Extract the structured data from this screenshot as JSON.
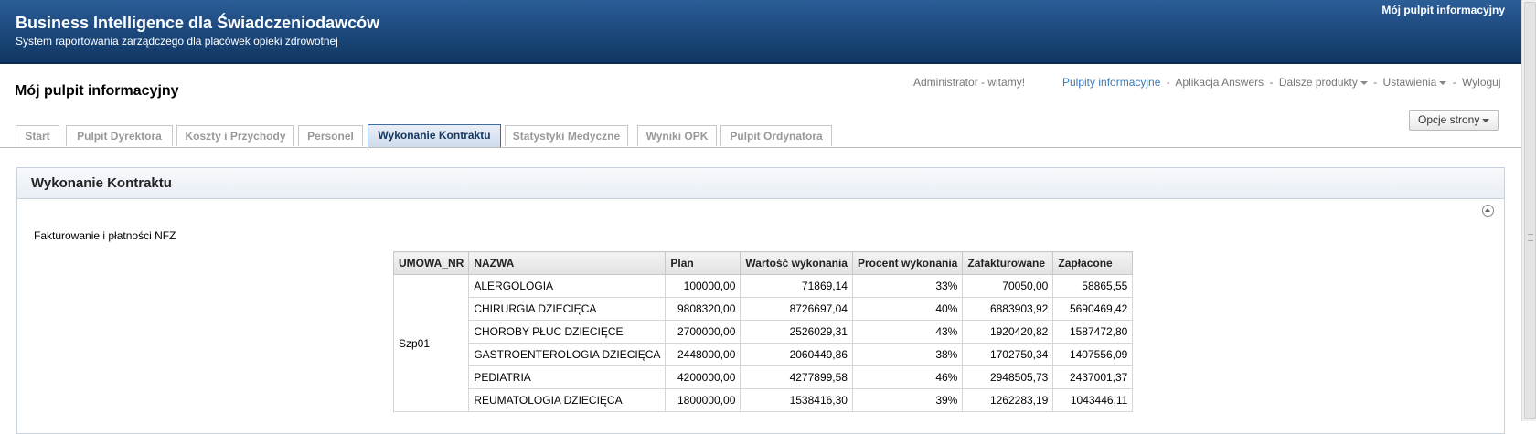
{
  "header": {
    "app_title": "Business Intelligence dla Świadczeniodawców",
    "app_subtitle": "System raportowania zarządczego dla placówek opieki zdrowotnej",
    "top_link": "Mój pulpit informacyjny"
  },
  "page": {
    "title": "Mój pulpit informacyjny",
    "welcome": "Administrator - witamy!",
    "options_label": "Opcje strony"
  },
  "global_nav": {
    "dashboards": "Pulpity informacyjne",
    "answers": "Aplikacja Answers",
    "more_products": "Dalsze produkty",
    "settings": "Ustawienia",
    "logout": "Wyloguj",
    "separator": "-"
  },
  "tabs": [
    {
      "label": "Start",
      "active": false
    },
    {
      "label": "Pulpit Dyrektora",
      "active": false
    },
    {
      "label": "Koszty i Przychody",
      "active": false
    },
    {
      "label": "Personel",
      "active": false
    },
    {
      "label": "Wykonanie Kontraktu",
      "active": true
    },
    {
      "label": "Statystyki Medyczne",
      "active": false
    },
    {
      "label": "Wyniki OPK",
      "active": false
    },
    {
      "label": "Pulpit Ordynatora",
      "active": false
    }
  ],
  "section": {
    "title": "Wykonanie Kontraktu",
    "report_caption": "Fakturowanie i płatności NFZ"
  },
  "table": {
    "columns": [
      "UMOWA_NR",
      "NAZWA",
      "Plan",
      "Wartość wykonania",
      "Procent wykonania",
      "Zafakturowane",
      "Zapłacone"
    ],
    "group": "Szp01",
    "rows": [
      [
        "ALERGOLOGIA",
        "100000,00",
        "71869,14",
        "33%",
        "70050,00",
        "58865,55"
      ],
      [
        "CHIRURGIA DZIECIĘCA",
        "9808320,00",
        "8726697,04",
        "40%",
        "6883903,92",
        "5690469,42"
      ],
      [
        "CHOROBY PŁUC DZIECIĘCE",
        "2700000,00",
        "2526029,31",
        "43%",
        "1920420,82",
        "1587472,80"
      ],
      [
        "GASTROENTEROLOGIA DZIECIĘCA",
        "2448000,00",
        "2060449,86",
        "38%",
        "1702750,34",
        "1407556,09"
      ],
      [
        "PEDIATRIA",
        "4200000,00",
        "4277899,58",
        "46%",
        "2948505,73",
        "2437001,37"
      ],
      [
        "REUMATOLOGIA DZIECIĘCA",
        "1800000,00",
        "1538416,30",
        "39%",
        "1262283,19",
        "1043446,11"
      ]
    ]
  }
}
